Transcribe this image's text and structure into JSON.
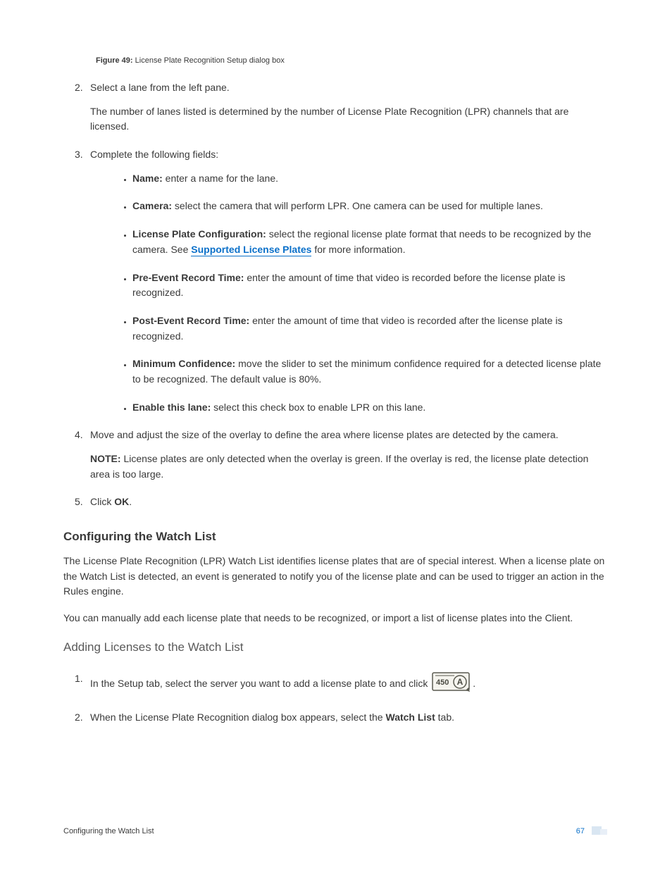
{
  "figure": {
    "label": "Figure 49:",
    "caption": "License Plate Recognition Setup dialog box"
  },
  "step2": {
    "lead": "Select a lane from the left pane.",
    "sub": "The number of lanes listed is determined by the number of License Plate Recognition (LPR) channels that are licensed."
  },
  "step3": {
    "lead": "Complete the following fields:",
    "fields": {
      "name": {
        "term": "Name:",
        "desc": " enter a name for the lane."
      },
      "camera": {
        "term": "Camera:",
        "desc": " select the camera that will perform LPR. One camera can be used for multiple lanes."
      },
      "lpc": {
        "term": "License Plate Configuration:",
        "desc_before": " select the regional license plate format that needs to be recognized by the camera. See ",
        "link": "Supported License Plates",
        "desc_after": " for more information."
      },
      "pre": {
        "term": "Pre-Event Record Time:",
        "desc": " enter the amount of time that video is recorded before the license plate is recognized."
      },
      "post": {
        "term": "Post-Event Record Time:",
        "desc": " enter the amount of time that video is recorded after the license plate is recognized."
      },
      "minconf": {
        "term": "Minimum Confidence:",
        "desc": " move the slider to set the minimum confidence required for a detected license plate to be recognized. The default value is 80%."
      },
      "enable": {
        "term": "Enable this lane:",
        "desc": " select this check box to enable LPR on this lane."
      }
    }
  },
  "step4": {
    "lead": "Move and adjust the size of the overlay to define the area where license plates are detected by the camera.",
    "note_term": "NOTE:",
    "note": " License plates are only detected when the overlay is green. If the overlay is red, the license plate detection area is too large."
  },
  "step5": {
    "prefix": "Click ",
    "ok": "OK",
    "suffix": "."
  },
  "section1": {
    "heading": "Configuring the Watch List",
    "p1": "The License Plate Recognition (LPR) Watch List identifies license plates that are of special interest. When a license plate on the Watch List is detected, an event is generated to notify you of the license plate and can be used to trigger an action in the Rules engine.",
    "p2": "You can manually add each license plate that needs to be recognized, or import a list of license plates into the Client."
  },
  "section2": {
    "heading": "Adding Licenses to the Watch List",
    "step1": {
      "before": "In the Setup tab, select the server you want to add a license plate to and click ",
      "after": "."
    },
    "step2": {
      "before": "When the License Plate Recognition dialog box appears, select the ",
      "bold": "Watch List",
      "after": " tab."
    }
  },
  "footer": {
    "left": "Configuring the Watch List",
    "page": "67"
  }
}
